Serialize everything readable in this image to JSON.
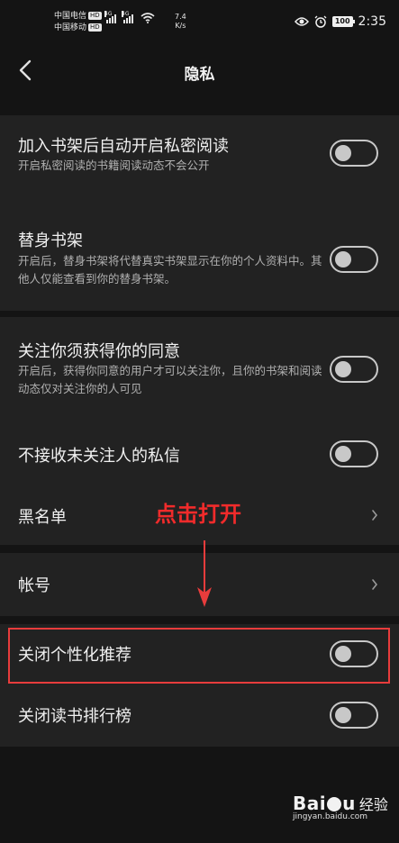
{
  "status_bar": {
    "carrier1": "中国电信",
    "carrier2": "中国移动",
    "hd_badge": "HD",
    "net_type": "4G",
    "speed_value": "7.4",
    "speed_unit": "K/s",
    "battery": "100",
    "time": "2:35",
    "icons": [
      "signal-icon",
      "wifi-icon",
      "eye-icon",
      "alarm-icon",
      "battery-icon"
    ]
  },
  "header": {
    "title": "隐私",
    "back_icon": "chevron-left-icon"
  },
  "settings": [
    {
      "title": "加入书架后自动开启私密阅读",
      "subtitle": "开启私密阅读的书籍阅读动态不会公开",
      "control": "toggle",
      "on": false
    },
    {
      "title": "替身书架",
      "subtitle": "开启后，替身书架将代替真实书架显示在你的个人资料中。其他人仅能查看到你的替身书架。",
      "control": "toggle",
      "on": false
    },
    {
      "title": "关注你须获得你的同意",
      "subtitle": "开启后，获得你同意的用户才可以关注你，且你的书架和阅读动态仅对关注你的人可见",
      "control": "toggle",
      "on": false
    },
    {
      "title": "不接收未关注人的私信",
      "subtitle": "",
      "control": "toggle",
      "on": false
    },
    {
      "title": "黑名单",
      "subtitle": "",
      "control": "chevron"
    },
    {
      "title": "帐号",
      "subtitle": "",
      "control": "chevron"
    },
    {
      "title": "关闭个性化推荐",
      "subtitle": "",
      "control": "toggle",
      "on": false
    },
    {
      "title": "关闭读书排行榜",
      "subtitle": "",
      "control": "toggle",
      "on": false
    }
  ],
  "annotation": {
    "text": "点击打开",
    "color": "#f12b2b"
  },
  "watermark": {
    "logo": "Bai",
    "logo_suffix": "u",
    "cn": "经验",
    "url": "jingyan.baidu.com"
  },
  "colors": {
    "background": "#141414",
    "section": "#222222",
    "toggle_off": "#c8c8c8",
    "highlight_box": "#e83c3c"
  }
}
